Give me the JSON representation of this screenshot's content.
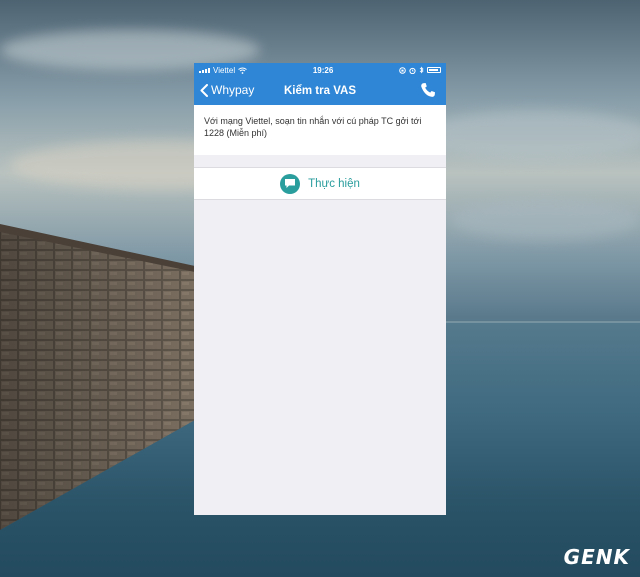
{
  "status_bar": {
    "carrier": "Viettel",
    "time": "19:26",
    "icons": [
      "signal-icon",
      "wifi-icon",
      "lock-rotation-icon",
      "alarm-icon",
      "bluetooth-icon",
      "battery-icon"
    ]
  },
  "nav": {
    "back_label": "Whypay",
    "title": "Kiểm tra VAS",
    "right_icon": "phone-icon"
  },
  "content": {
    "description": "Với mạng Viettel, soạn tin nhắn với cú pháp TC gởi tới 1228 (Miễn phí)",
    "action_label": "Thực hiện",
    "action_icon": "message-icon"
  },
  "watermark": "GENK",
  "colors": {
    "accent": "#2f86d6",
    "action": "#2a9d9d",
    "background": "#efeff4"
  }
}
